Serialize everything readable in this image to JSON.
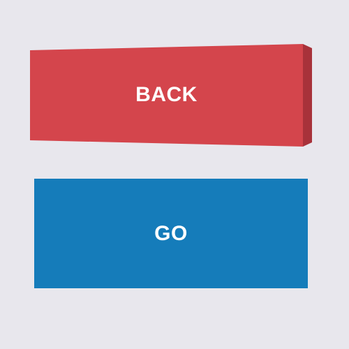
{
  "buttons": {
    "back": {
      "label": "BACK",
      "face_color": "#d4454c",
      "side_color": "#a8323a"
    },
    "go": {
      "label": "GO",
      "color": "#157cba"
    }
  },
  "background_color": "#e8e7ed",
  "text_color": "#ffffff"
}
